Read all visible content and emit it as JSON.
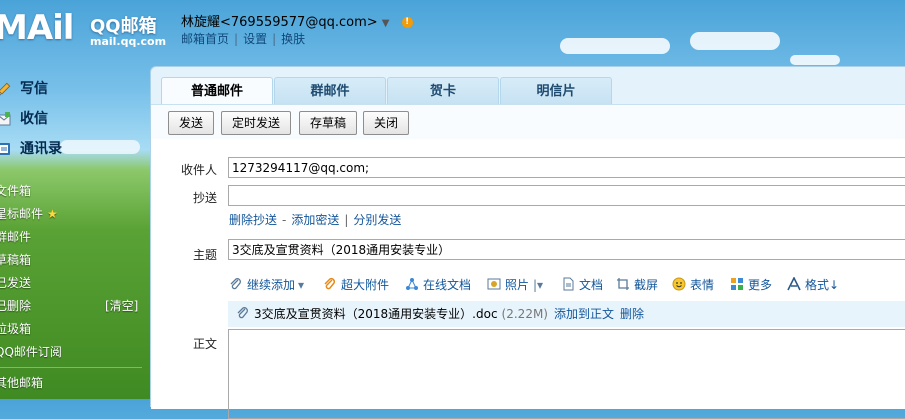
{
  "header": {
    "logo_mark": "MAil",
    "logo_text": "QQ邮箱",
    "logo_url": "mail.qq.com",
    "user": "林旋耀<769559577@qq.com>",
    "user_menu_arrow": "▼",
    "warn_mark": "!",
    "links": [
      "邮箱首页",
      "设置",
      "换肤"
    ]
  },
  "sidebar": {
    "nav": [
      {
        "label": "写信",
        "icon": "pencil-icon"
      },
      {
        "label": "收信",
        "icon": "inbox-icon"
      },
      {
        "label": "通讯录",
        "icon": "contacts-icon"
      }
    ],
    "folders": [
      "文件箱",
      "星标邮件",
      "群邮件",
      "草稿箱",
      "已发送",
      "已删除",
      "垃圾箱",
      "QQ邮件订阅"
    ],
    "star": "★",
    "clear_label": "[清空]",
    "other": "其他邮箱"
  },
  "tabs": [
    "普通邮件",
    "群邮件",
    "贺卡",
    "明信片"
  ],
  "toolbar": {
    "send": "发送",
    "scheduled": "定时发送",
    "save_draft": "存草稿",
    "close": "关闭"
  },
  "compose": {
    "to_label": "收件人",
    "to_value": "1273294117@qq.com;",
    "cc_label": "抄送",
    "cc_value": "",
    "cc_links": [
      "删除抄送",
      "添加密送",
      "分别发送"
    ],
    "subject_label": "主题",
    "subject_value": "3交底及宣贯资料（2018通用安装专业）",
    "body_label": "正文"
  },
  "attach_tools": [
    {
      "label": "继续添加",
      "icon": "paperclip-icon"
    },
    {
      "label": "超大附件",
      "icon": "large-attachment-icon"
    },
    {
      "label": "在线文档",
      "icon": "share-doc-icon"
    },
    {
      "label": "照片",
      "icon": "photo-icon"
    },
    {
      "label": "文档",
      "icon": "document-icon"
    },
    {
      "label": "截屏",
      "icon": "screenshot-icon"
    },
    {
      "label": "表情",
      "icon": "emoji-icon"
    },
    {
      "label": "更多",
      "icon": "more-icon"
    },
    {
      "label": "格式↓",
      "icon": "format-icon"
    }
  ],
  "attachment": {
    "name": "3交底及宣贯资料（2018通用安装专业）.doc",
    "size": "(2.22M)",
    "add_to_body": "添加到正文",
    "delete": "删除"
  },
  "colors": {
    "link": "#13569a",
    "panel_bg": "#e3f2fb",
    "warn": "#f29b0c"
  }
}
